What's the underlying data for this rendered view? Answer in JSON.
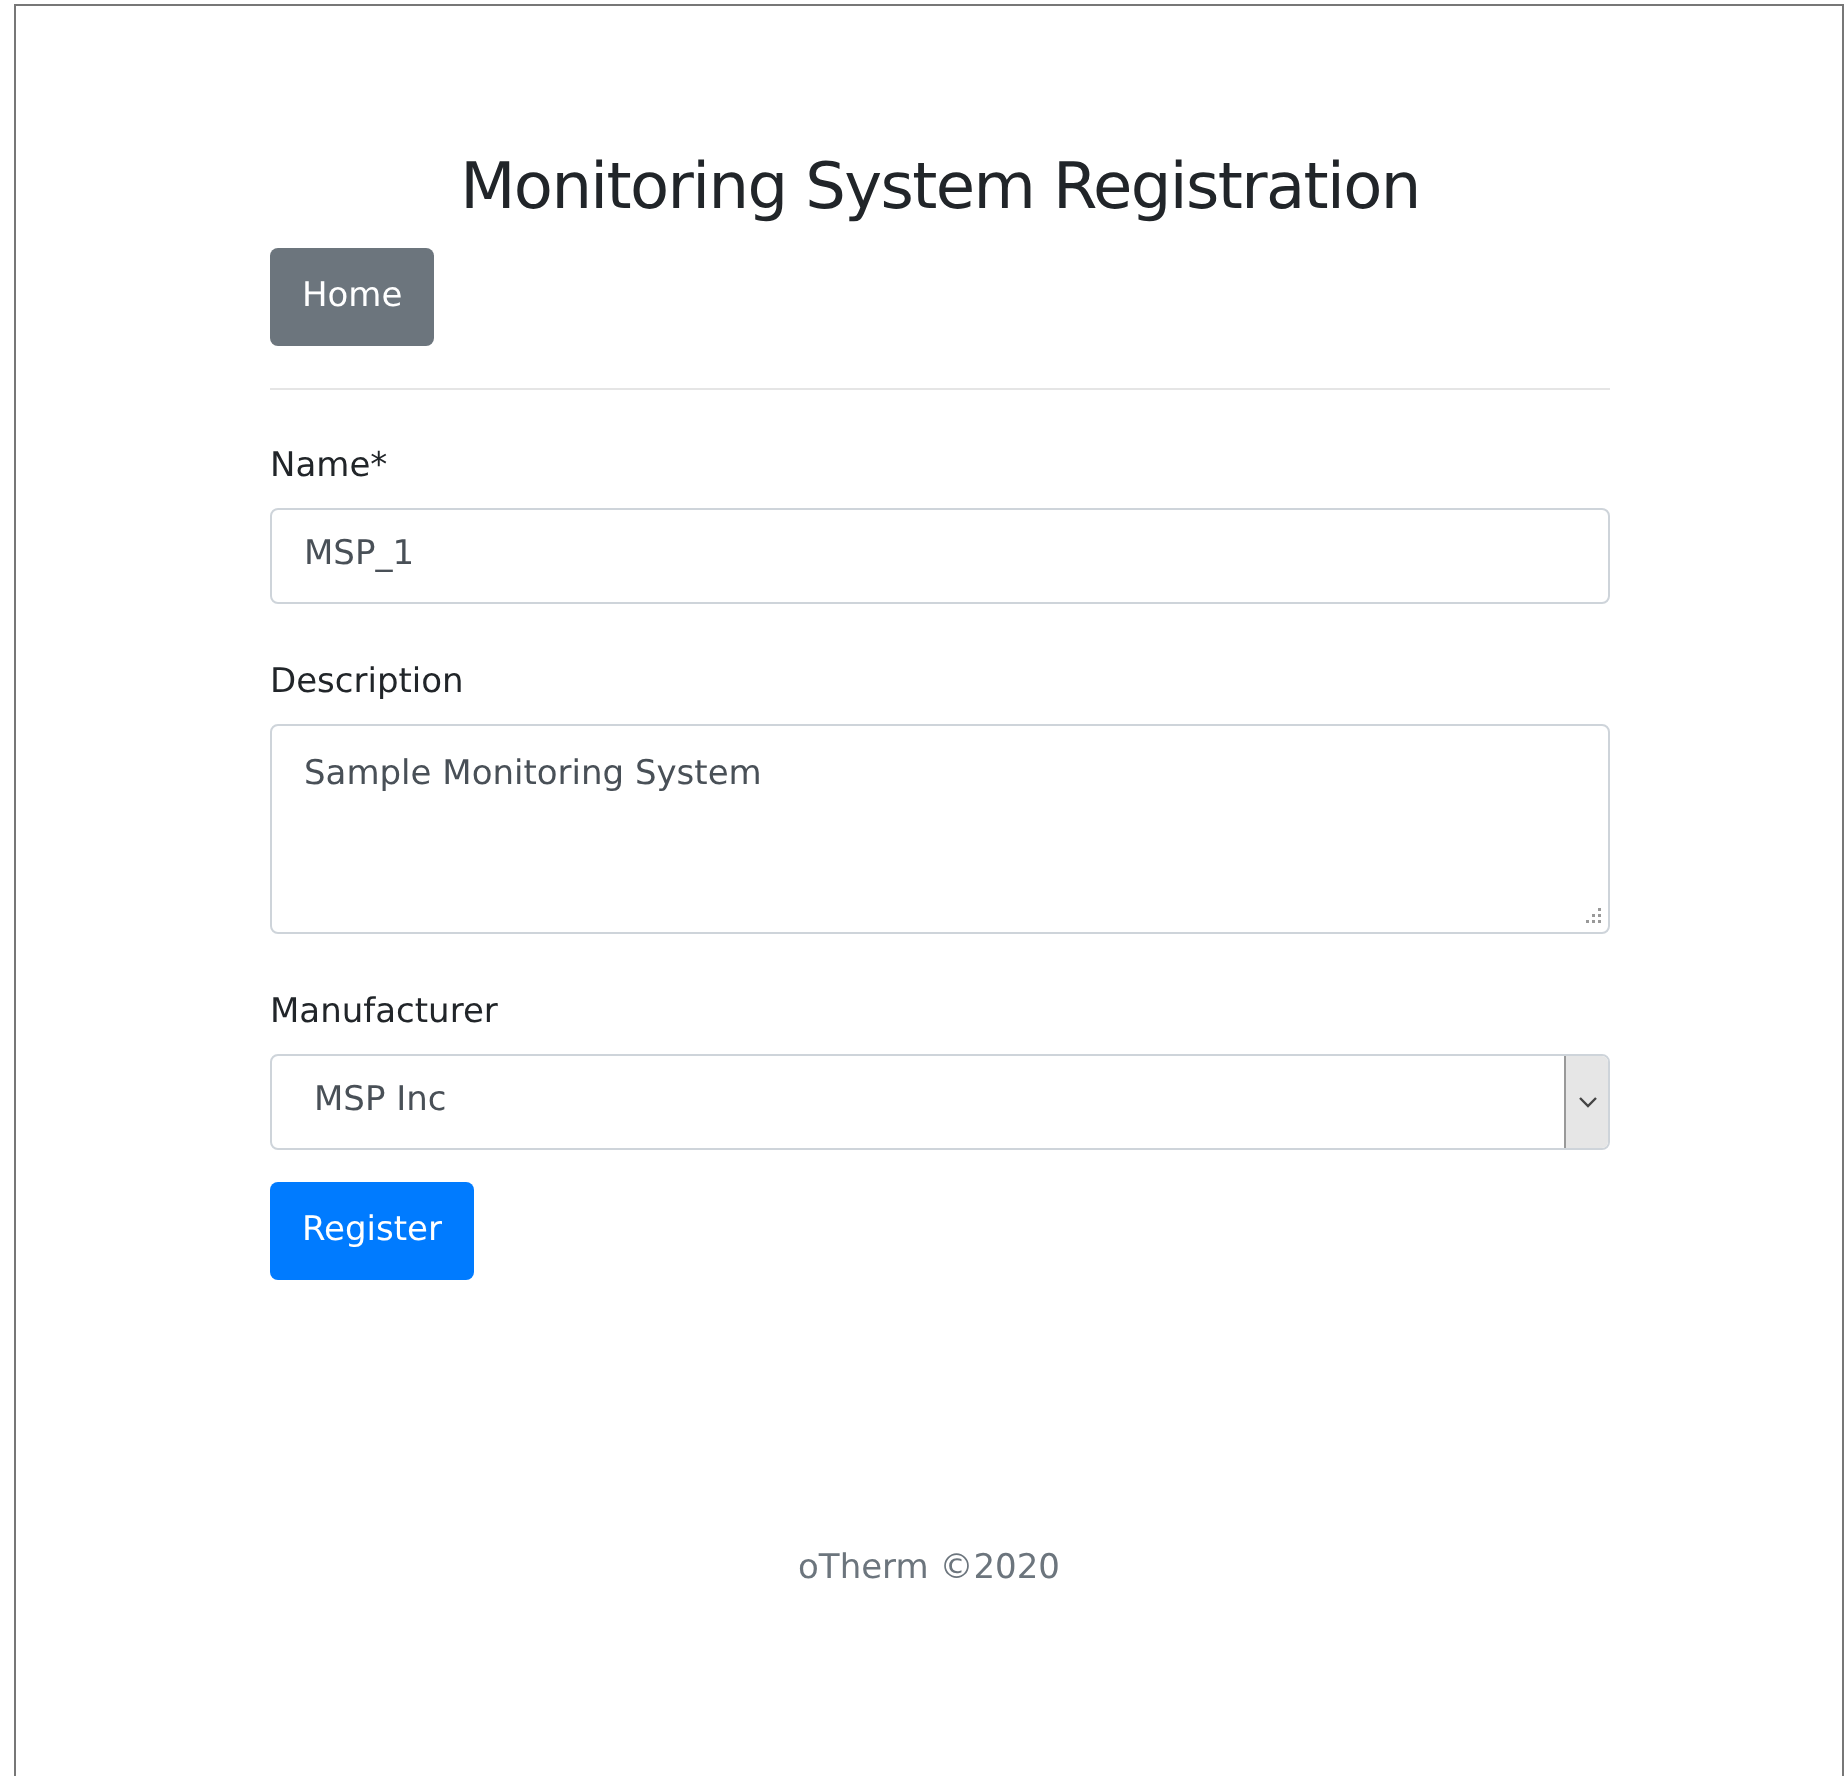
{
  "title": "Monitoring System Registration",
  "nav_button": "Home",
  "fields": [
    {
      "kind": "text",
      "label": "Name*",
      "value": "MSP_1"
    },
    {
      "kind": "textarea",
      "label": "Description",
      "value": "Sample Monitoring System"
    },
    {
      "kind": "select",
      "label": "Manufacturer",
      "value": "MSP Inc"
    }
  ],
  "submit_button": "Register",
  "footer": "oTherm ©2020"
}
